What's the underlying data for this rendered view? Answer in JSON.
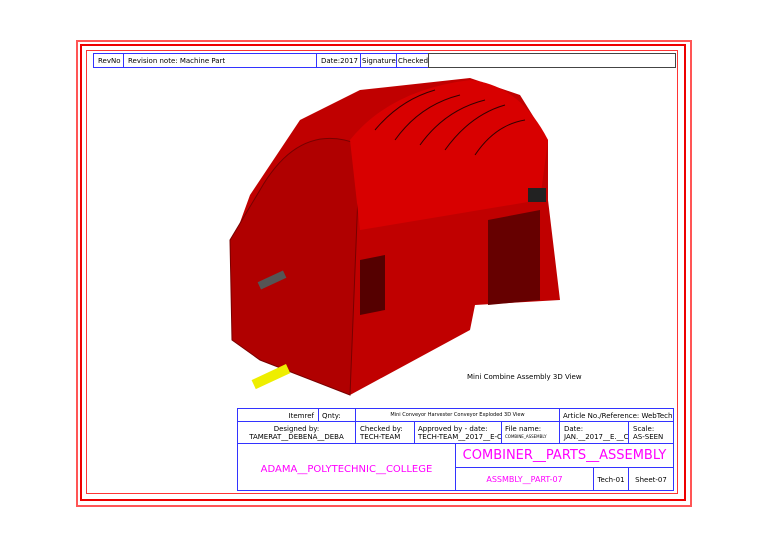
{
  "revision_bar": {
    "rev_no": "RevNo",
    "note": "Revision note: Machine Part",
    "date": "Date:2017",
    "signature": "Signature",
    "checked": "Checked"
  },
  "view_caption": "Mini Combine Assembly 3D View",
  "title_block": {
    "itemref": "Itemref",
    "qty": "Qnty:",
    "drawing_title": "Mini Conveyor Harvester Conveyor Exploded 3D View",
    "article": "Article No./Reference: WebTech",
    "designed_label": "Designed by:",
    "designed_value": "TAMERAT__DEBENA__DEBA",
    "checked_label": "Checked by:",
    "checked_value": "TECH-TEAM",
    "approved_label": "Approved by - date:",
    "approved_value": "TECH-TEAM__2017__E-C.",
    "file_label": "File name:",
    "file_value": "COMBINE_ASSEMBLY",
    "date_label": "Date:",
    "date_value": "JAN.__2017__E.__C.",
    "scale_label": "Scale:",
    "scale_value": "AS-SEEN",
    "college": "ADAMA__POLYTECHNIC__COLLEGE",
    "assembly_title": "COMBINER__PARTS__ASSEMBLY",
    "part": "ASSMBLY__PART-07",
    "tech": "Tech-01",
    "sheet": "Sheet-07"
  },
  "colors": {
    "border": "#ff3333",
    "grid": "#3333ff",
    "title_text": "#ff00ff",
    "model": "#c00000"
  }
}
